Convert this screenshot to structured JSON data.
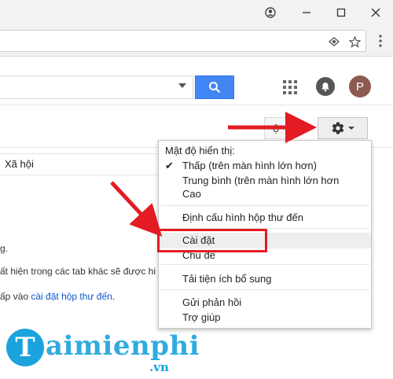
{
  "browser": {
    "icons": {
      "account": "account-icon",
      "minimize": "minimize-icon",
      "maximize": "maximize-icon",
      "close": "close-icon",
      "lens": "lens-icon",
      "bookmark": "star-icon",
      "menu": "more-vert-icon"
    }
  },
  "header": {
    "search_button_icon": "search-icon",
    "avatar_letter": "P"
  },
  "toolbar": {
    "keyboard_label": "ộ"
  },
  "tabs": {
    "social_label": "Xã hội"
  },
  "body": {
    "line1": "g.",
    "line2": "ất hiện trong các tab khác sẽ được hi",
    "line3_prefix": "ấp vào ",
    "line3_link": "cài đặt hộp thư đến",
    "line3_suffix": "."
  },
  "menu": {
    "density_heading": "Mật độ hiển thị:",
    "density_options": [
      "Thấp (trên màn hình lớn hơn)",
      "Trung bình (trên màn hình lớn hơn",
      "Cao"
    ],
    "selected_density_index": 0,
    "configure_inbox": "Định cấu hình hộp thư đến",
    "settings": "Cài đặt",
    "themes": "Chủ đề",
    "addons": "Tải tiện ích bổ sung",
    "feedback": "Gửi phản hồi",
    "help": "Trợ giúp"
  },
  "watermark": {
    "letter": "T",
    "text": "aimienphi",
    "suffix": ".vn"
  },
  "colors": {
    "search_button": "#4285f4",
    "highlight": "#e31b23",
    "arrow": "#e31b23",
    "watermark": "#1aa3dc",
    "link": "#1155cc"
  }
}
